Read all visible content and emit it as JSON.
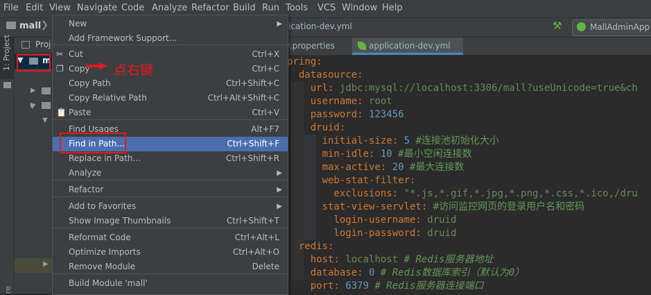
{
  "menubar": {
    "items": [
      "File",
      "Edit",
      "View",
      "Navigate",
      "Code",
      "Analyze",
      "Refactor",
      "Build",
      "Run",
      "Tools",
      "VCS",
      "Window",
      "Help"
    ]
  },
  "navbar": {
    "project_name": "mall",
    "editor_file": "ication-dev.yml",
    "run_config": "MallAdminApp"
  },
  "toolstrip": {
    "project_tab": "1: Project",
    "bottom_label": "re"
  },
  "project_panel": {
    "header_label": "Proj",
    "root_label": "m"
  },
  "tabs": [
    {
      "label": "r.properties"
    },
    {
      "label": "application-dev.yml"
    }
  ],
  "annotation": {
    "text": "点右键",
    "color": "#e8171c"
  },
  "context_menu": {
    "items": [
      {
        "label": "New",
        "shortcut": "",
        "submenu": true
      },
      {
        "label": "Add Framework Support...",
        "shortcut": "",
        "submenu": false
      },
      {
        "label": "Cut",
        "shortcut": "Ctrl+X",
        "icon": "cut-icon"
      },
      {
        "label": "Copy",
        "shortcut": "Ctrl+C",
        "icon": "copy-icon"
      },
      {
        "label": "Copy Path",
        "shortcut": "Ctrl+Shift+C"
      },
      {
        "label": "Copy Relative Path",
        "shortcut": "Ctrl+Alt+Shift+C"
      },
      {
        "label": "Paste",
        "shortcut": "Ctrl+V",
        "icon": "paste-icon"
      },
      {
        "label": "Find Usages",
        "shortcut": "Alt+F7"
      },
      {
        "label": "Find in Path...",
        "shortcut": "Ctrl+Shift+F",
        "selected": true
      },
      {
        "label": "Replace in Path...",
        "shortcut": "Ctrl+Shift+R"
      },
      {
        "label": "Analyze",
        "shortcut": "",
        "submenu": true
      },
      {
        "label": "Refactor",
        "shortcut": "",
        "submenu": true
      },
      {
        "label": "Add to Favorites",
        "shortcut": "",
        "submenu": true
      },
      {
        "label": "Show Image Thumbnails",
        "shortcut": "Ctrl+Shift+T"
      },
      {
        "label": "Reformat Code",
        "shortcut": "Ctrl+Alt+L"
      },
      {
        "label": "Optimize Imports",
        "shortcut": "Ctrl+Alt+O"
      },
      {
        "label": "Remove Module",
        "shortcut": "Delete"
      },
      {
        "label": "Build Module 'mall'",
        "shortcut": ""
      }
    ]
  },
  "editor": {
    "lines": [
      {
        "k": "pring:"
      },
      {
        "k": "  datasource:"
      },
      {
        "k": "    url: ",
        "s": "jdbc:mysql://localhost:3306/mall?useUnicode=true&ch"
      },
      {
        "k": "    username: ",
        "s": "root"
      },
      {
        "k": "    password: ",
        "n": "123456"
      },
      {
        "k": "    druid:"
      },
      {
        "k": "      initial-size: ",
        "n": "5",
        "c": " #连接池初始化大小"
      },
      {
        "k": "      min-idle: ",
        "n": "10",
        "c": " #最小空闲连接数"
      },
      {
        "k": "      max-active: ",
        "n": "20",
        "c": " #最大连接数"
      },
      {
        "k": "      web-stat-filter:"
      },
      {
        "k": "        exclusions: ",
        "s": "\"*.js,*.gif,*.jpg,*.png,*.css,*.ico,/dru"
      },
      {
        "k": "      stat-view-servlet:",
        "c": " #访问监控网页的登录用户名和密码"
      },
      {
        "k": "        login-username: ",
        "s": "druid"
      },
      {
        "k": "        login-password: ",
        "s": "druid"
      },
      {
        "k": "  redis:"
      },
      {
        "k": "    host: ",
        "s": "localhost",
        "ci": " # Redis服务器地址"
      },
      {
        "k": "    database: ",
        "n": "0",
        "ci": " # Redis数据库索引（默认为0）"
      },
      {
        "k": "    port: ",
        "n": "6379",
        "ci": " # Redis服务器连接端口"
      }
    ]
  }
}
